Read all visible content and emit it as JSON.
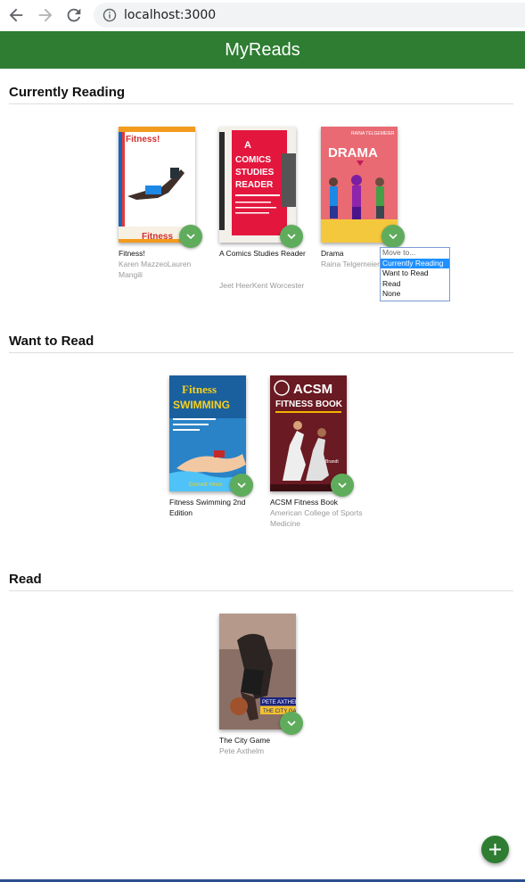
{
  "browser": {
    "url": "localhost:3000",
    "icons": [
      "back-arrow-icon",
      "forward-arrow-icon",
      "reload-icon",
      "info-icon"
    ]
  },
  "app": {
    "title": "MyReads"
  },
  "shelves": [
    {
      "title": "Currently Reading",
      "books": [
        {
          "title": "Fitness!",
          "authors": "Karen MazzeoLauren Mangili",
          "cover": {
            "color": "#ffffff",
            "accent": "#f29b1d",
            "text": "Fitness!"
          }
        },
        {
          "title": "A Comics Studies Reader",
          "authors": "Jeet HeerKent Worcester",
          "cover": {
            "color": "#f3f0ea",
            "accent": "#e3173e",
            "text": "A COMICS STUDIES READER"
          }
        },
        {
          "title": "Drama",
          "authors": "Raina Telgemeier",
          "cover": {
            "color": "#e96a73",
            "accent": "#f4c83c",
            "text": "DRAMA"
          }
        }
      ]
    },
    {
      "title": "Want to Read",
      "books": [
        {
          "title": "Fitness Swimming 2nd Edition",
          "authors": "",
          "cover": {
            "color": "#2a83c6",
            "accent": "#f6d01e",
            "text": "Fitness SWIMMING"
          }
        },
        {
          "title": "ACSM Fitness Book",
          "authors": "American College of Sports Medicine",
          "cover": {
            "color": "#6a1a22",
            "accent": "#ffffff",
            "text": "ACSM FITNESS BOOK"
          }
        }
      ]
    },
    {
      "title": "Read",
      "books": [
        {
          "title": "The City Game",
          "authors": "Pete Axthelm",
          "cover": {
            "color": "#8a6f66",
            "accent": "#f3c22e",
            "text": "PETE AXTHELM THE CITY GAME"
          }
        }
      ]
    }
  ],
  "move_menu": {
    "options": [
      "Move to...",
      "Currently Reading",
      "Want to Read",
      "Read",
      "None"
    ],
    "selected": "Currently Reading"
  },
  "colors": {
    "header": "#2e7d32",
    "changer": "#60ac5d",
    "selected_option": "#1e90ff"
  },
  "add_button": {
    "icon": "plus-icon"
  }
}
